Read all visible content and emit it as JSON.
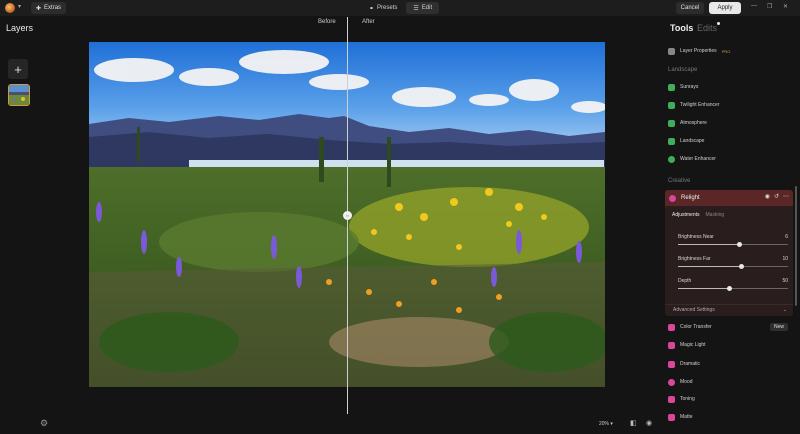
{
  "titlebar": {
    "extras_label": "Extras",
    "presets_label": "Presets",
    "edit_label": "Edit",
    "cancel_label": "Cancel",
    "apply_label": "Apply"
  },
  "layers": {
    "title": "Layers"
  },
  "canvas": {
    "before_label": "Before",
    "after_label": "After",
    "zoom": "20%"
  },
  "tools": {
    "title": "Tools",
    "edits_tab": "Edits",
    "layer_properties": "Layer Properties",
    "layer_properties_badge": "PRO",
    "landscape_section": "Landscape",
    "landscape_items": [
      {
        "label": "Sunrays",
        "icon": "sun-icon",
        "color": "#3fae5a"
      },
      {
        "label": "Twilight Enhancer",
        "icon": "moon-icon",
        "color": "#3fae5a"
      },
      {
        "label": "Atmosphere",
        "icon": "lines-icon",
        "color": "#3fae5a"
      },
      {
        "label": "Landscape",
        "icon": "mountain-icon",
        "color": "#3fae5a"
      },
      {
        "label": "Water Enhancer",
        "icon": "drop-icon",
        "color": "#3fae5a"
      }
    ],
    "creative_section": "Creative",
    "relight": {
      "title": "Relight",
      "tab_adjustments": "Adjustments",
      "tab_masking": "Masking",
      "sliders": [
        {
          "label": "Brightness Near",
          "value": "6",
          "fraction": 0.56
        },
        {
          "label": "Brightness Far",
          "value": "10",
          "fraction": 0.58
        },
        {
          "label": "Depth",
          "value": "50",
          "fraction": 0.47
        }
      ],
      "advanced_label": "Advanced Settings"
    },
    "creative_items": [
      {
        "label": "Color Transfer",
        "icon": "transfer-icon",
        "color": "#d8479a"
      },
      {
        "label": "Magic Light",
        "icon": "sparkle-icon",
        "color": "#d8479a"
      },
      {
        "label": "Dramatic",
        "icon": "bolt-icon",
        "color": "#d8479a"
      },
      {
        "label": "Mood",
        "icon": "mood-icon",
        "color": "#d8479a"
      },
      {
        "label": "Toning",
        "icon": "toning-icon",
        "color": "#d8479a"
      },
      {
        "label": "Matte",
        "icon": "matte-icon",
        "color": "#d8479a"
      }
    ],
    "new_badge": "New"
  }
}
